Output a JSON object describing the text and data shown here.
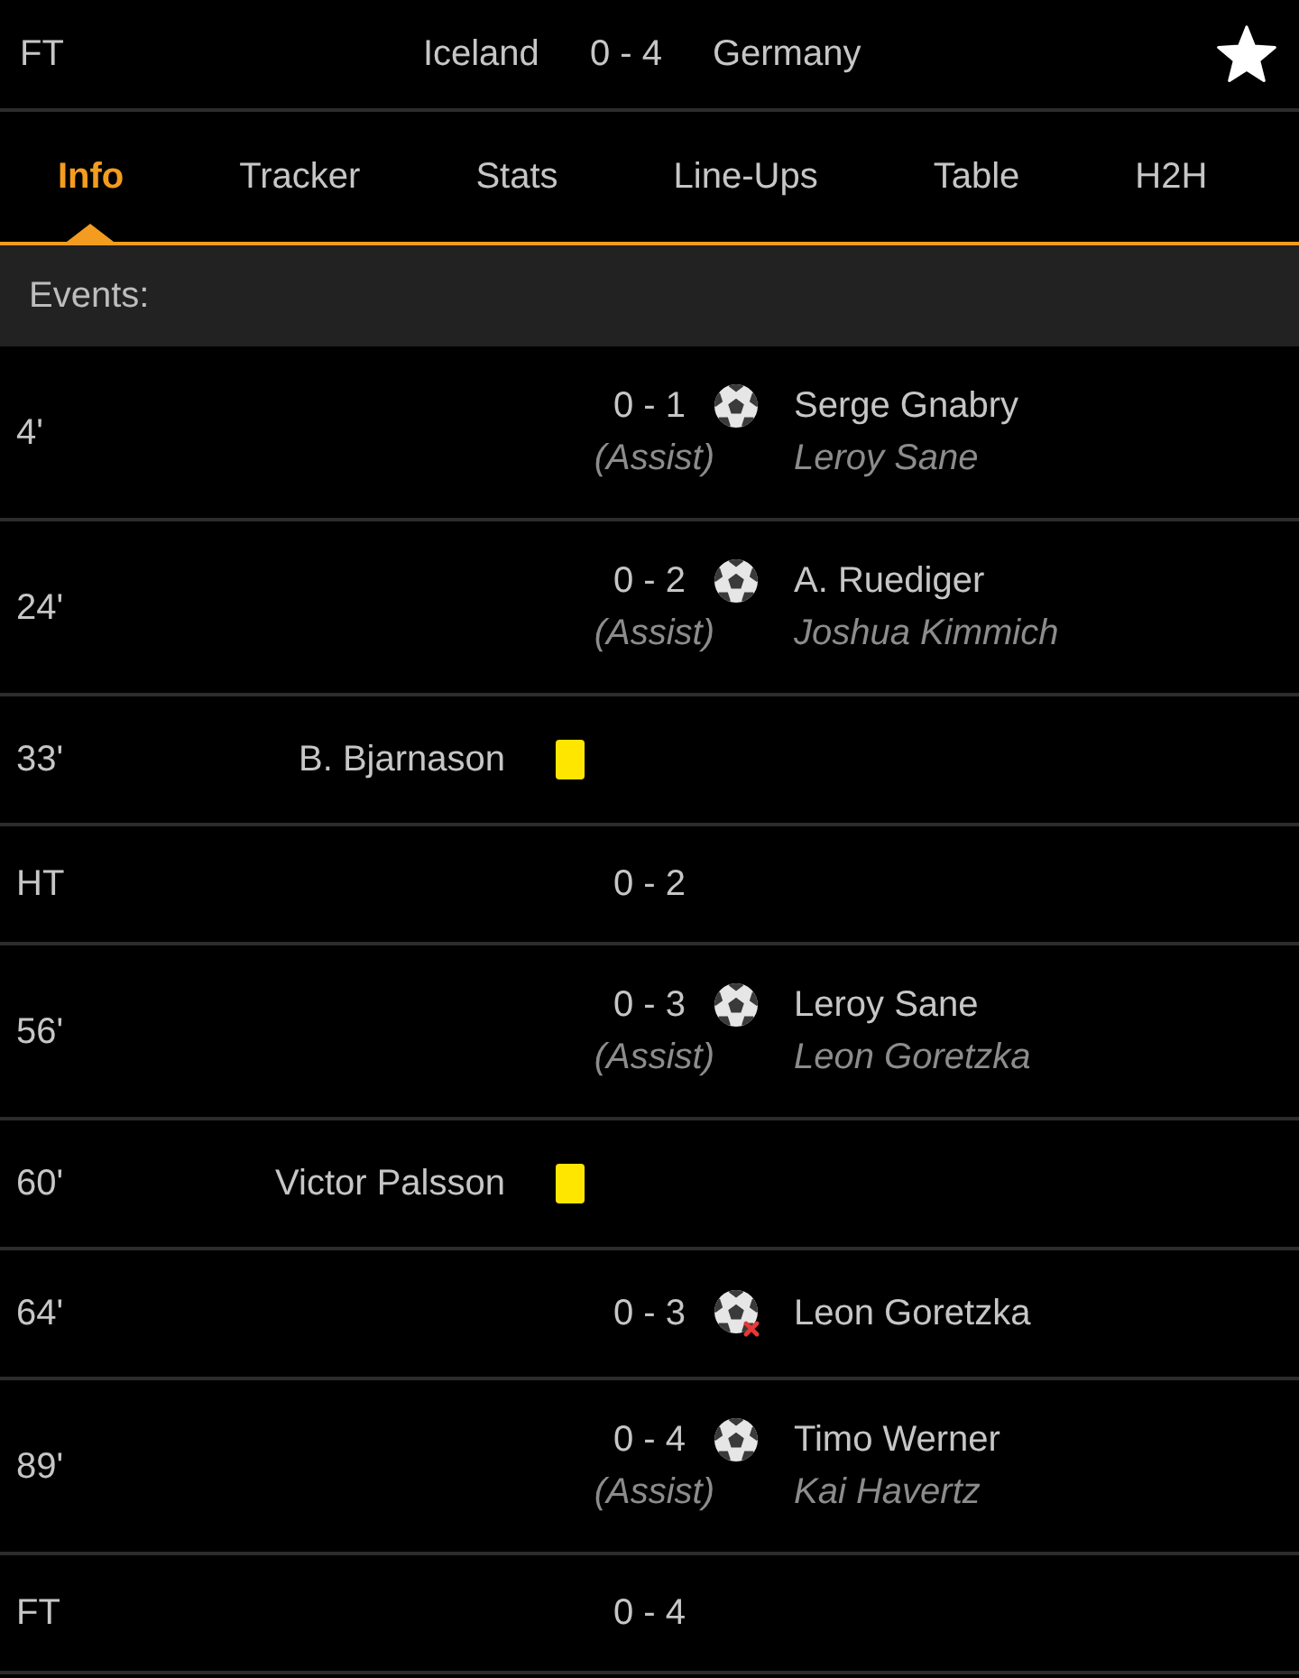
{
  "header": {
    "status": "FT",
    "home_team": "Iceland",
    "score": "0 - 4",
    "away_team": "Germany",
    "favorite": true
  },
  "tabs": [
    {
      "label": "Info",
      "selected": true
    },
    {
      "label": "Tracker",
      "selected": false
    },
    {
      "label": "Stats",
      "selected": false
    },
    {
      "label": "Line-Ups",
      "selected": false
    },
    {
      "label": "Table",
      "selected": false
    },
    {
      "label": "H2H",
      "selected": false
    }
  ],
  "section_title": "Events:",
  "events": [
    {
      "kind": "goal",
      "home": false,
      "minute": "4'",
      "score": "0 - 1",
      "player": "Serge Gnabry",
      "assist_label": "(Assist)",
      "assist": "Leroy Sane"
    },
    {
      "kind": "goal",
      "home": false,
      "minute": "24'",
      "score": "0 - 2",
      "player": "A. Ruediger",
      "assist_label": "(Assist)",
      "assist": "Joshua Kimmich"
    },
    {
      "kind": "yellow_card",
      "home": true,
      "minute": "33'",
      "player": "B. Bjarnason"
    },
    {
      "kind": "period",
      "minute": "HT",
      "score": "0 - 2"
    },
    {
      "kind": "goal",
      "home": false,
      "minute": "56'",
      "score": "0 - 3",
      "player": "Leroy Sane",
      "assist_label": "(Assist)",
      "assist": "Leon Goretzka"
    },
    {
      "kind": "yellow_card",
      "home": true,
      "minute": "60'",
      "player": "Victor Palsson"
    },
    {
      "kind": "disallowed_goal",
      "home": false,
      "minute": "64'",
      "score": "0 - 3",
      "player": "Leon Goretzka"
    },
    {
      "kind": "goal",
      "home": false,
      "minute": "89'",
      "score": "0 - 4",
      "player": "Timo Werner",
      "assist_label": "(Assist)",
      "assist": "Kai Havertz"
    },
    {
      "kind": "period",
      "minute": "FT",
      "score": "0 - 4"
    }
  ]
}
